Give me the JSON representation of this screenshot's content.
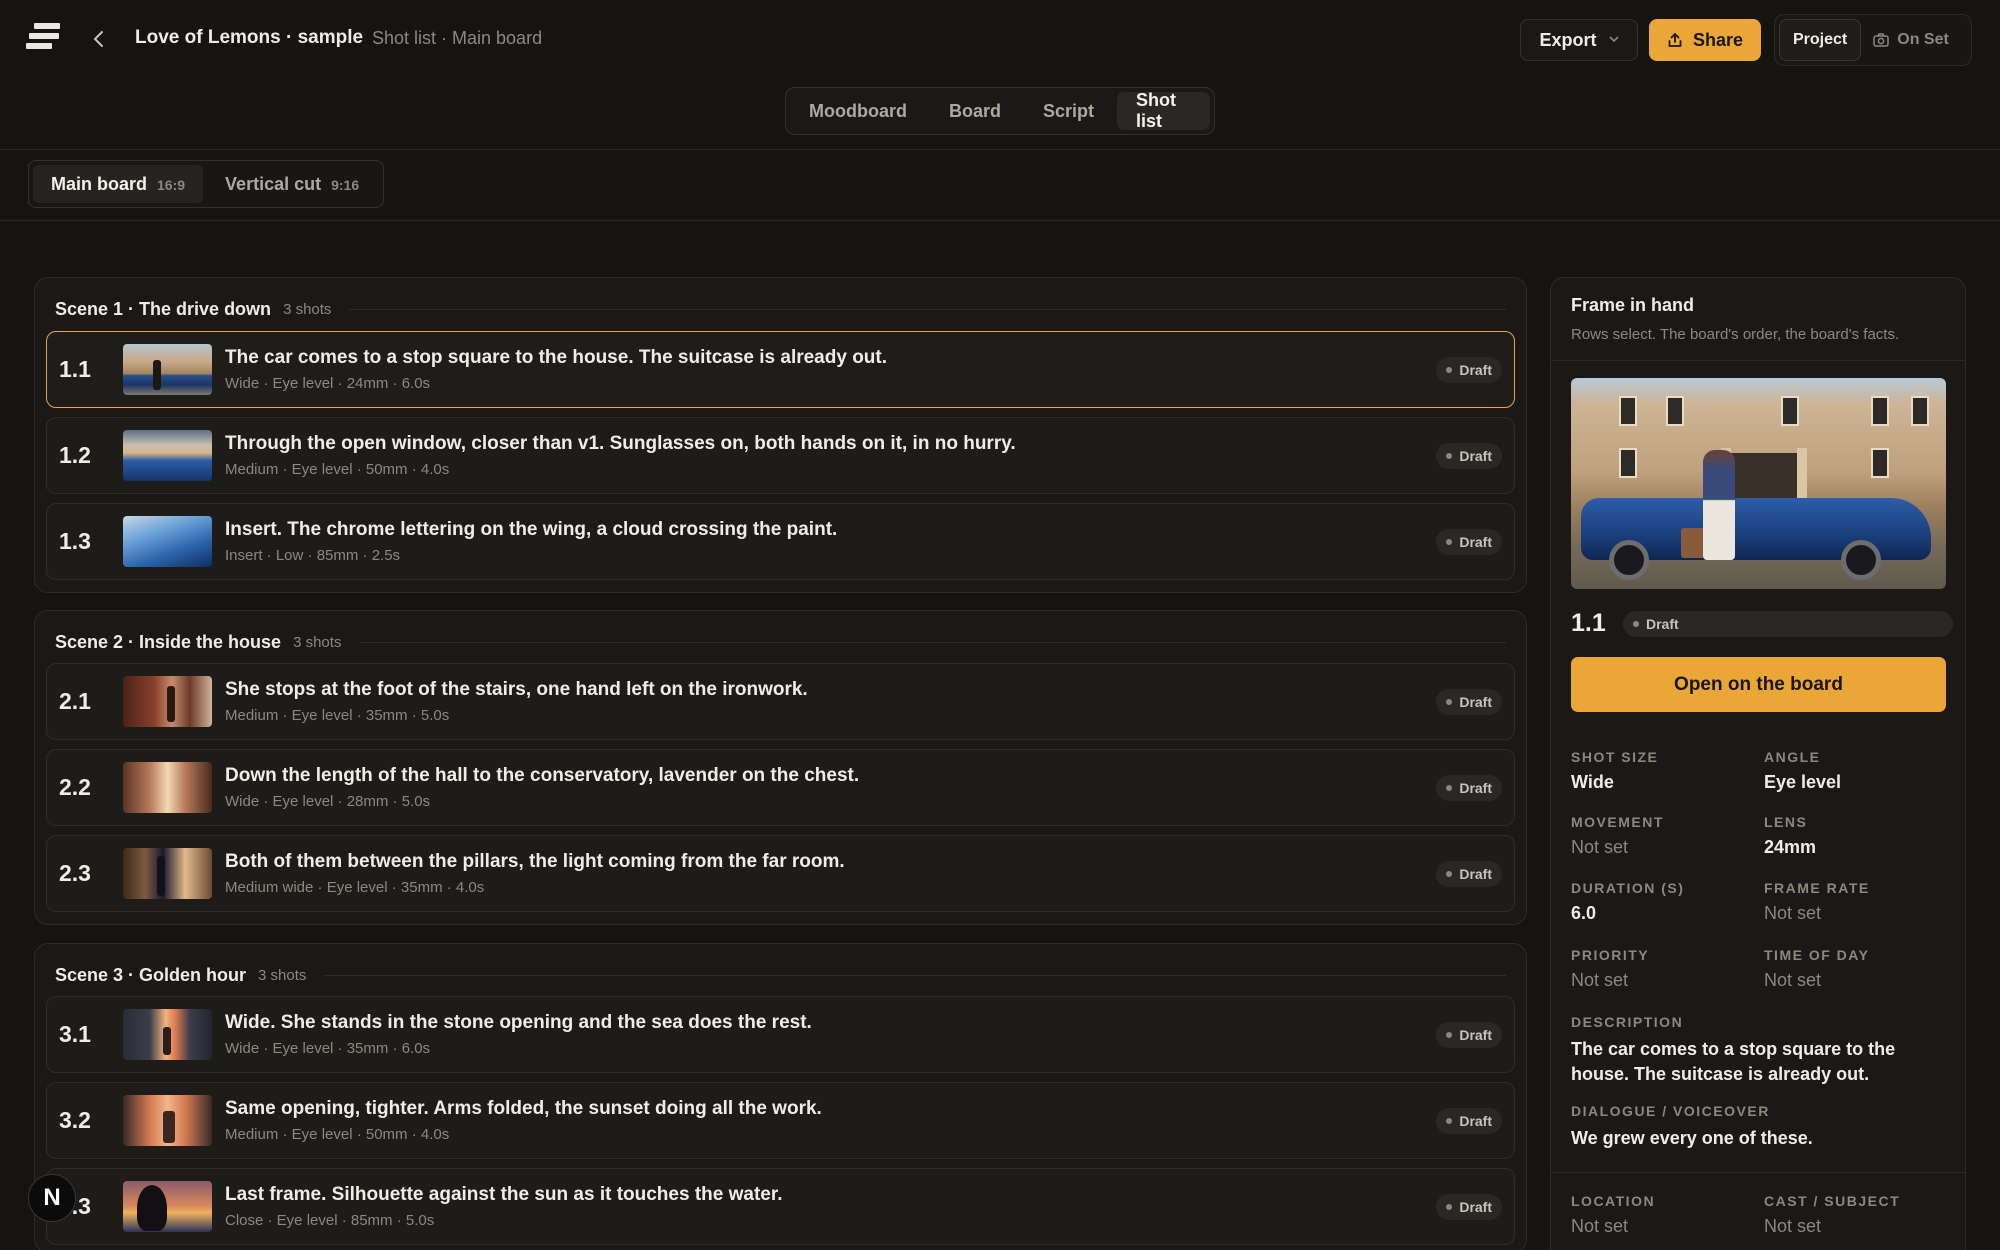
{
  "header": {
    "project_title": "Love of Lemons · sample",
    "breadcrumb": "Shot list · Main board",
    "export_label": "Export",
    "share_label": "Share",
    "mode_project": "Project",
    "mode_on_set": "On Set"
  },
  "view_tabs": [
    {
      "label": "Moodboard",
      "active": false
    },
    {
      "label": "Board",
      "active": false
    },
    {
      "label": "Script",
      "active": false
    },
    {
      "label": "Shot list",
      "active": true
    }
  ],
  "board_tabs": [
    {
      "label": "Main board",
      "ratio": "16:9",
      "active": true
    },
    {
      "label": "Vertical cut",
      "ratio": "9:16",
      "active": false
    }
  ],
  "scenes": [
    {
      "title": "Scene 1 · The drive down",
      "count": "3 shots",
      "shots": [
        {
          "num": "1.1",
          "desc": "The car comes to a stop square to the house. The suitcase is already out.",
          "meta": "Wide · Eye level · 24mm · 6.0s",
          "status": "Draft",
          "selected": true
        },
        {
          "num": "1.2",
          "desc": "Through the open window, closer than v1. Sunglasses on, both hands on it, in no hurry.",
          "meta": "Medium · Eye level · 50mm · 4.0s",
          "status": "Draft",
          "selected": false
        },
        {
          "num": "1.3",
          "desc": "Insert. The chrome lettering on the wing, a cloud crossing the paint.",
          "meta": "Insert · Low · 85mm · 2.5s",
          "status": "Draft",
          "selected": false
        }
      ]
    },
    {
      "title": "Scene 2 · Inside the house",
      "count": "3 shots",
      "shots": [
        {
          "num": "2.1",
          "desc": "She stops at the foot of the stairs, one hand left on the ironwork.",
          "meta": "Medium · Eye level · 35mm · 5.0s",
          "status": "Draft",
          "selected": false
        },
        {
          "num": "2.2",
          "desc": "Down the length of the hall to the conservatory, lavender on the chest.",
          "meta": "Wide · Eye level · 28mm · 5.0s",
          "status": "Draft",
          "selected": false
        },
        {
          "num": "2.3",
          "desc": "Both of them between the pillars, the light coming from the far room.",
          "meta": "Medium wide · Eye level · 35mm · 4.0s",
          "status": "Draft",
          "selected": false
        }
      ]
    },
    {
      "title": "Scene 3 · Golden hour",
      "count": "3 shots",
      "shots": [
        {
          "num": "3.1",
          "desc": "Wide. She stands in the stone opening and the sea does the rest.",
          "meta": "Wide · Eye level · 35mm · 6.0s",
          "status": "Draft",
          "selected": false
        },
        {
          "num": "3.2",
          "desc": "Same opening, tighter. Arms folded, the sunset doing all the work.",
          "meta": "Medium · Eye level · 50mm · 4.0s",
          "status": "Draft",
          "selected": false
        },
        {
          "num": "3.3",
          "desc": "Last frame. Silhouette against the sun as it touches the water.",
          "meta": "Close · Eye level · 85mm · 5.0s",
          "status": "Draft",
          "selected": false
        }
      ]
    }
  ],
  "panel": {
    "title": "Frame in hand",
    "subtitle": "Rows select. The board's order, the board's facts.",
    "selected_num": "1.1",
    "selected_status": "Draft",
    "open_button": "Open on the board",
    "fields": {
      "shot_size": {
        "label": "SHOT SIZE",
        "value": "Wide"
      },
      "angle": {
        "label": "ANGLE",
        "value": "Eye level"
      },
      "movement": {
        "label": "MOVEMENT",
        "value": "Not set"
      },
      "lens": {
        "label": "LENS",
        "value": "24mm"
      },
      "duration": {
        "label": "DURATION (S)",
        "value": "6.0"
      },
      "frame_rate": {
        "label": "FRAME RATE",
        "value": "Not set"
      },
      "priority": {
        "label": "PRIORITY",
        "value": "Not set"
      },
      "time_of_day": {
        "label": "TIME OF DAY",
        "value": "Not set"
      },
      "description": {
        "label": "DESCRIPTION",
        "value": "The car comes to a stop square to the house. The suitcase is already out."
      },
      "dialogue": {
        "label": "DIALOGUE / VOICEOVER",
        "value": "We grew every one of these."
      },
      "location": {
        "label": "LOCATION",
        "value": "Not set"
      },
      "cast": {
        "label": "CAST / SUBJECT",
        "value": "Not set"
      }
    }
  },
  "floating_badge": "N"
}
